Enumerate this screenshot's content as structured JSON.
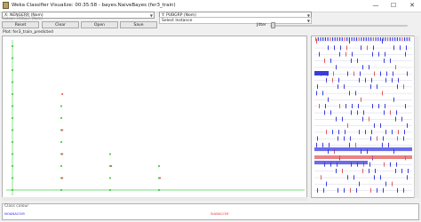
{
  "window": {
    "title": "Weka Classifier Visualize: 00:35:58 - bayes.NaiveBayes (fer3_train)",
    "minimize_glyph": "—",
    "maximize_glyph": "☐",
    "close_glyph": "✕"
  },
  "axes": {
    "x_select": "X: NENGERR (Nom)",
    "y_select": "Y: PUBGRP (Nom)",
    "colour_select": "Colour: TARGET (Nom)",
    "select_instance": "Select Instance"
  },
  "buttons": {
    "reset": "Reset",
    "clear": "Clear",
    "open": "Open",
    "save": "Save"
  },
  "jitter": {
    "label": "Jitter",
    "value": 0.02
  },
  "plot": {
    "title": "Plot: fer3_train_predicted"
  },
  "legend": {
    "title": "Class colour",
    "classes": [
      {
        "label": "NOANACOM",
        "color": "#2a2adf"
      },
      {
        "label": "SIANACOM",
        "color": "#e03a3a"
      }
    ]
  },
  "colors": {
    "point_green": "#39c23b",
    "point_red": "#e25b5b",
    "accent_blue": "#3b3be0",
    "axis_green": "#48d14a"
  },
  "chart_data": {
    "type": "scatter",
    "xlabel": "",
    "ylabel": "",
    "series": [
      {
        "name": "NOANACOM",
        "x": [
          0,
          0,
          0,
          0,
          0,
          0,
          0,
          0,
          0,
          0,
          0,
          0,
          0,
          1,
          1,
          1,
          1,
          1,
          1,
          1,
          1,
          2,
          2,
          2,
          2,
          3,
          3,
          3
        ],
        "y": [
          0,
          1,
          2,
          3,
          4,
          5,
          6,
          7,
          8,
          9,
          10,
          11,
          12,
          0,
          1,
          2,
          3,
          4,
          5,
          6,
          7,
          0,
          1,
          2,
          3,
          0,
          1,
          2
        ]
      },
      {
        "name": "SIANACOM",
        "x": [
          1,
          1,
          1,
          1,
          2,
          3
        ],
        "y": [
          1,
          3,
          5,
          8,
          2,
          1
        ]
      }
    ]
  }
}
